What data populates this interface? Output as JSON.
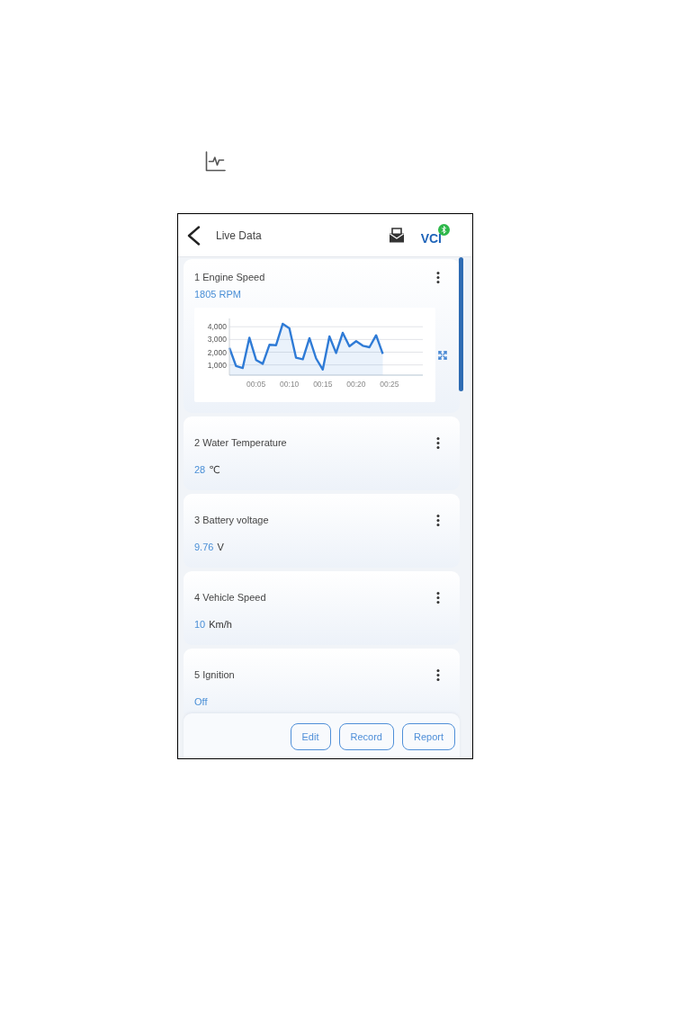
{
  "header": {
    "title": "Live Data",
    "logo": "VCI"
  },
  "items": [
    {
      "kind": "chart",
      "label": "1 Engine Speed",
      "value": "1805 RPM",
      "chart_data": {
        "type": "area",
        "x": [
          1,
          2,
          3,
          4,
          5,
          6,
          7,
          8,
          9,
          10,
          11,
          12,
          13,
          14,
          15,
          16,
          17,
          18,
          19,
          20,
          21,
          22,
          23,
          24
        ],
        "series": [
          {
            "color": "#2f7bd6",
            "values": [
              2340,
              920,
              760,
              3140,
              1390,
              1090,
              2580,
              2550,
              4230,
              3880,
              1560,
              1440,
              3100,
              1510,
              640,
              3240,
              1940,
              3520,
              2460,
              2860,
              2510,
              2390,
              3330,
              1870
            ]
          }
        ],
        "xlim": [
          1,
          30
        ],
        "ylim": [
          200,
          4650
        ],
        "xticks": [
          {
            "value": 5,
            "label": "00:05"
          },
          {
            "value": 10,
            "label": "00:10"
          },
          {
            "value": 15,
            "label": "00:15"
          },
          {
            "value": 20,
            "label": "00:20"
          },
          {
            "value": 25,
            "label": "00:25"
          }
        ],
        "yticks": [
          {
            "value": 1000,
            "label": "1,000"
          },
          {
            "value": 2000,
            "label": "2,000"
          },
          {
            "value": 3000,
            "label": "3,000"
          },
          {
            "value": 4000,
            "label": "4,000"
          }
        ],
        "grid": true
      }
    },
    {
      "kind": "value",
      "label": "2 Water Temperature",
      "value": "28",
      "unit": "℃"
    },
    {
      "kind": "value",
      "label": "3 Battery voltage",
      "value": "9.76",
      "unit": "V"
    },
    {
      "kind": "value",
      "label": "4 Vehicle Speed",
      "value": "10",
      "unit": "Km/h"
    },
    {
      "kind": "value",
      "label": "5 Ignition",
      "value": "Off"
    }
  ],
  "buttons": [
    "Edit",
    "Record",
    "Report"
  ]
}
